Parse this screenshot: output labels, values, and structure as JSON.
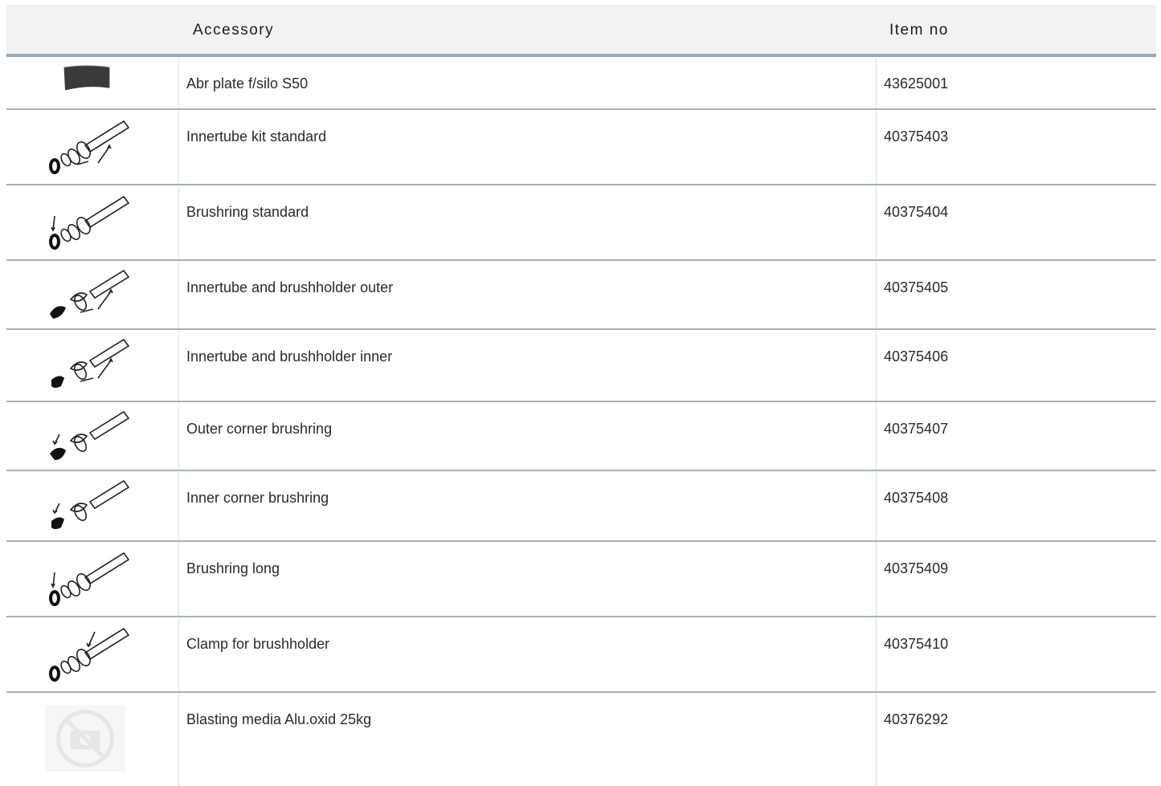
{
  "header": {
    "accessory": "Accessory",
    "item_no": "Item no"
  },
  "rows": [
    {
      "name": "Abr plate f/silo S50",
      "item_no": "43625001",
      "icon": "abrasive-plate-icon"
    },
    {
      "name": "Innertube kit standard",
      "item_no": "40375403",
      "icon": "innertube-kit-icon"
    },
    {
      "name": "Brushring standard",
      "item_no": "40375404",
      "icon": "brushring-icon"
    },
    {
      "name": "Innertube and brushholder outer",
      "item_no": "40375405",
      "icon": "innertube-brushholder-outer-icon"
    },
    {
      "name": "Innertube and brushholder inner",
      "item_no": "40375406",
      "icon": "innertube-brushholder-inner-icon"
    },
    {
      "name": "Outer corner brushring",
      "item_no": "40375407",
      "icon": "outer-corner-brushring-icon"
    },
    {
      "name": "Inner corner brushring",
      "item_no": "40375408",
      "icon": "inner-corner-brushring-icon"
    },
    {
      "name": "Brushring long",
      "item_no": "40375409",
      "icon": "brushring-long-icon"
    },
    {
      "name": "Clamp for brushholder",
      "item_no": "40375410",
      "icon": "clamp-icon"
    },
    {
      "name": "Blasting media Alu.oxid 25kg",
      "item_no": "40376292",
      "icon": "no-image-icon"
    }
  ]
}
